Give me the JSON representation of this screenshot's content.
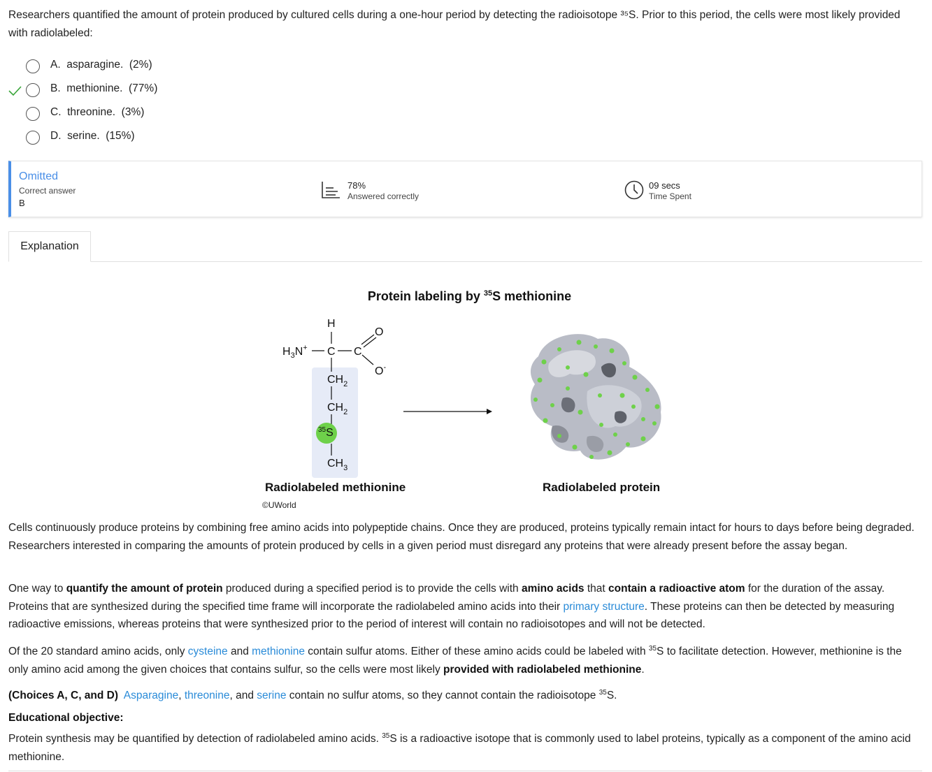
{
  "question": {
    "text": "Researchers quantified the amount of protein produced by cultured cells during a one-hour period by detecting the radioisotope ³⁵S.  Prior to this period, the cells were most likely provided with radiolabeled:"
  },
  "choices": [
    {
      "text": "A.  asparagine.  (2%)",
      "correct": false
    },
    {
      "text": "B.  methionine.  (77%)",
      "correct": true
    },
    {
      "text": "C.  threonine.  (3%)",
      "correct": false
    },
    {
      "text": "D.  serine.  (15%)",
      "correct": false
    }
  ],
  "stats": {
    "status": "Omitted",
    "correct_answer_label": "Correct answer",
    "correct_answer_value": "B",
    "percent_value": "78%",
    "percent_label": "Answered correctly",
    "time_value": "09 secs",
    "time_label": "Time Spent"
  },
  "tabs": {
    "explanation": "Explanation"
  },
  "figure": {
    "title_pre": "Protein labeling by ",
    "title_sup": "35",
    "title_post": "S methionine",
    "caption_left": "Radiolabeled methionine",
    "caption_right": "Radiolabeled protein",
    "copyright": "©UWorld",
    "labels": {
      "h": "H",
      "o_top": "O",
      "o_minus": "O",
      "minus": "-",
      "amine": "H",
      "amine_sub": "3",
      "amine_n": "N",
      "plus": "+",
      "c_alpha": "C",
      "c_carboxyl": "C",
      "ch": "CH",
      "two": "2",
      "three": "3",
      "iso_sup": "35",
      "iso_s": "S"
    },
    "colors": {
      "accent_green": "#6ed14a",
      "highlight": "#e6ebf7",
      "protein_gray": "#b9bcc6"
    }
  },
  "explanation": {
    "p1": "Cells continuously produce proteins by combining free amino acids into polypeptide chains.  Once they are produced, proteins typically remain intact for hours to days before being degraded.  Researchers interested in comparing the amounts of protein produced by cells in a given period must disregard any proteins that were already present before the assay began.",
    "p2": {
      "a": "One way to ",
      "b": "quantify the amount of protein",
      "c": " produced during a specified period is to provide the cells with ",
      "d": "amino acids",
      "e": " that ",
      "f": "contain a radioactive atom",
      "g": " for the duration of the assay.  Proteins that are synthesized during the specified time frame will incorporate the radiolabeled amino acids into their ",
      "link": "primary structure",
      "h": ".  These proteins can then be detected by measuring radioactive emissions, whereas proteins that were synthesized prior to the period of interest will contain no radioisotopes and will not be detected."
    },
    "p3": {
      "a": "Of the 20 standard amino acids, only ",
      "link1": "cysteine",
      "b": " and ",
      "link2": "methionine",
      "c": " contain sulfur atoms.  Either of these amino acids could be labeled with ",
      "sup": "35",
      "d": "S to facilitate detection.  However, methionine is the only amino acid among the given choices that contains sulfur, so the cells were most likely ",
      "bold": "provided with radiolabeled methionine",
      "e": "."
    },
    "p4": {
      "bold": "(Choices A, C, and D)",
      "link1": "Asparagine",
      "comma": ", ",
      "link2": "threonine",
      "and": ", and ",
      "link3": "serine",
      "rest": " contain no sulfur atoms, so they cannot contain the radioisotope ",
      "sup": "35",
      "end": "S."
    },
    "objective_title": "Educational objective:",
    "objective_a": "Protein synthesis may be quantified by detection of radiolabeled amino acids.  ",
    "objective_sup": "35",
    "objective_b": "S is a radioactive isotope that is commonly used to label proteins, typically as a component of the amino acid methionine."
  }
}
